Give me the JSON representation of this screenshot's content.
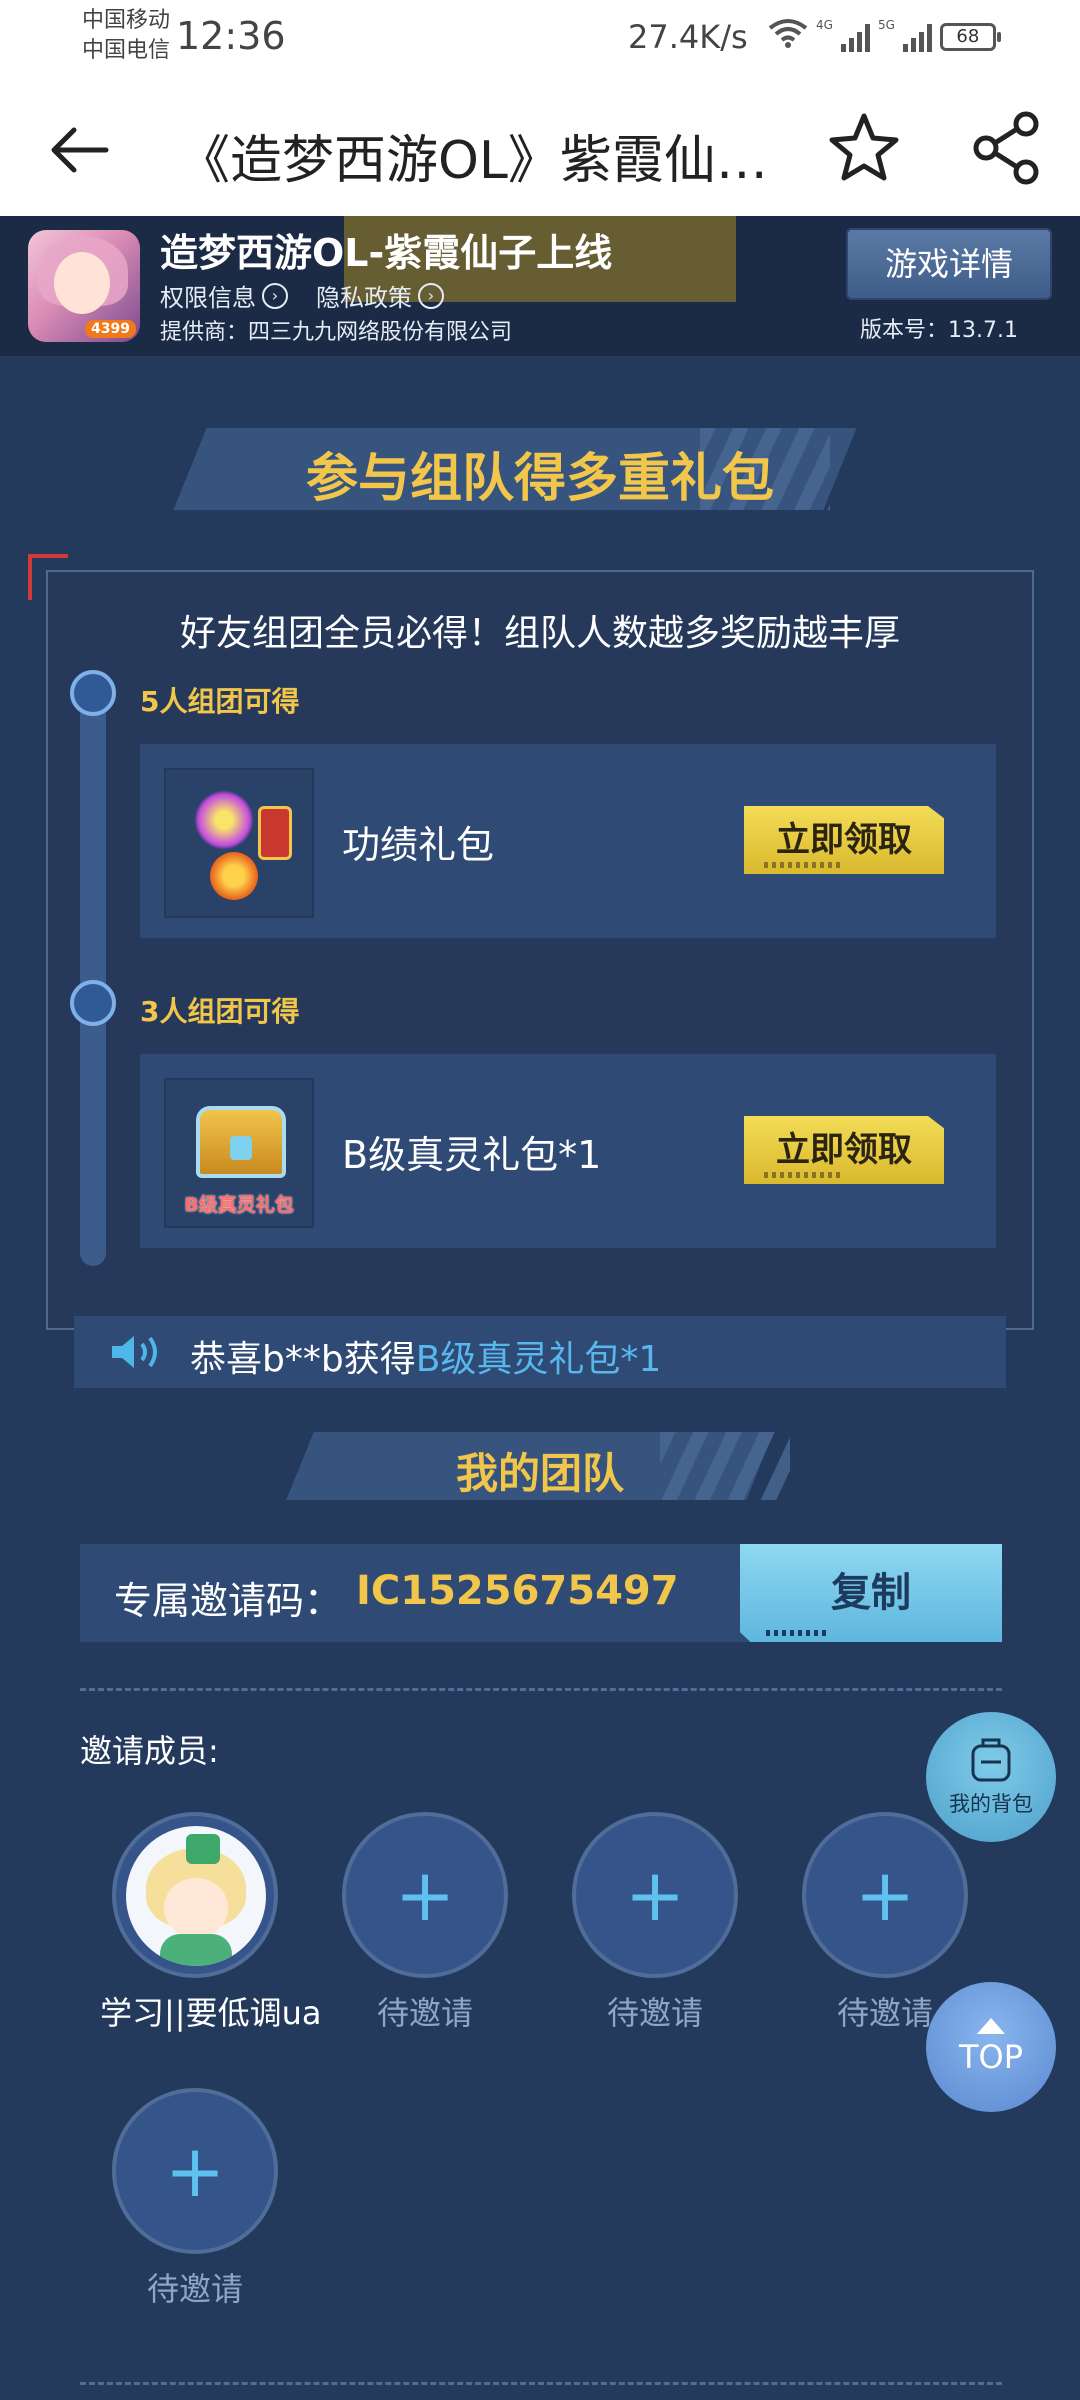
{
  "status_bar": {
    "carrier_1": "中国移动",
    "carrier_2": "中国电信",
    "time": "12:36",
    "speed": "27.4K/s",
    "net_1": "4G",
    "net_2": "5G",
    "battery": "68"
  },
  "app_bar": {
    "title": "《造梦西游OL》紫霞仙…",
    "icons": [
      "back-arrow-icon",
      "star-icon",
      "share-icon"
    ]
  },
  "game": {
    "name": "造梦西游OL-紫霞仙子上线",
    "icon_tag": "4399",
    "permissions": "权限信息",
    "privacy": "隐私政策",
    "provider": "提供商：四三九九网络股份有限公司",
    "details_button": "游戏详情",
    "version": "版本号：13.7.1"
  },
  "team_up": {
    "title": "参与组队得多重礼包",
    "subtitle": "好友组团全员必得！组队人数越多奖励越丰厚",
    "tiers": [
      {
        "label": "5人组团可得",
        "reward": "功绩礼包",
        "button": "立即领取",
        "icon": "merit-gift-icon"
      },
      {
        "label": "3人组团可得",
        "reward": "B级真灵礼包*1",
        "button": "立即领取",
        "icon": "treasure-chest-icon",
        "icon_caption": "B级真灵礼包"
      }
    ]
  },
  "notice": {
    "prefix": "恭喜b**b获得",
    "highlight": "B级真灵礼包*1"
  },
  "my_team": {
    "title": "我的团队",
    "invite_label": "专属邀请码：",
    "invite_code": "IC1525675497",
    "copy_button": "复制",
    "members_label": "邀请成员:",
    "members": [
      {
        "name": "学习||要低调ua",
        "filled": true
      },
      {
        "name": "待邀请",
        "filled": false
      },
      {
        "name": "待邀请",
        "filled": false
      },
      {
        "name": "待邀请",
        "filled": false
      },
      {
        "name": "待邀请",
        "filled": false
      }
    ]
  },
  "floating": {
    "bag": "我的背包",
    "top": "TOP"
  },
  "colors": {
    "background": "#243a5c",
    "accent_gold": "#f1c64a",
    "highlight_blue": "#58b8ee"
  }
}
